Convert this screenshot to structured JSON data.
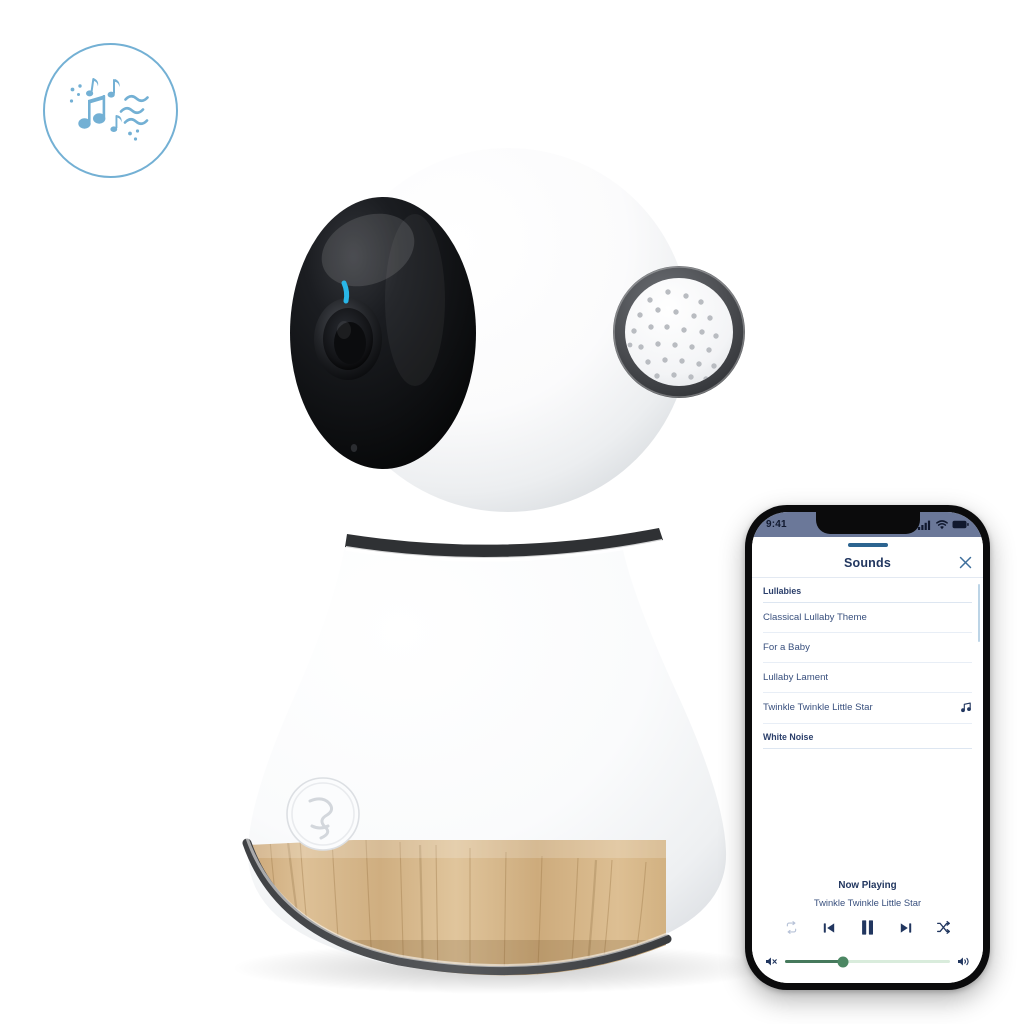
{
  "scene": {
    "background_color": "#ffffff",
    "badge": {
      "name": "sounds-feature-badge",
      "border_color": "#73b0d4",
      "icon": "music-notes-and-waves-icon"
    },
    "device": {
      "name": "baby-monitor-camera",
      "body_color": "#ffffff",
      "lens_face_color": "#111111",
      "led_color": "#29b6e8",
      "trim_color": "#4d4f52",
      "wood_color": "#d4b283",
      "speaker_ring_color": "#4a4c4f",
      "button_icon": "baby-logo-icon"
    }
  },
  "phone": {
    "frame_color": "#0b0b0c",
    "status_bar": {
      "background_color": "#6b7899",
      "time": "9:41",
      "cellular_icon": "signal-bars-icon",
      "wifi_icon": "wifi-icon",
      "battery_icon": "battery-icon"
    },
    "sheet": {
      "grabber_color": "#2c6490",
      "title": "Sounds",
      "close_icon": "close-icon",
      "accent_color": "#21365f"
    },
    "list": {
      "scrollbar_color": "#bcd4e6",
      "sections": [
        {
          "header": "Lullabies",
          "items": [
            {
              "label": "Classical Lullaby Theme",
              "icon": null
            },
            {
              "label": "For a Baby",
              "icon": null
            },
            {
              "label": "Lullaby Lament",
              "icon": null
            },
            {
              "label": "Twinkle Twinkle Little Star",
              "icon": "music-note-icon"
            }
          ]
        },
        {
          "header": "White Noise",
          "items": []
        }
      ]
    },
    "now_playing": {
      "title": "Now Playing",
      "track": "Twinkle Twinkle Little Star",
      "controls": [
        {
          "name": "repeat-button",
          "icon": "repeat-icon",
          "state": "inactive"
        },
        {
          "name": "previous-button",
          "icon": "previous-track-icon",
          "state": "active"
        },
        {
          "name": "pause-button",
          "icon": "pause-icon",
          "state": "active"
        },
        {
          "name": "next-button",
          "icon": "next-track-icon",
          "state": "active"
        },
        {
          "name": "shuffle-button",
          "icon": "shuffle-icon",
          "state": "active"
        }
      ]
    },
    "volume": {
      "mute_icon": "volume-mute-icon",
      "max_icon": "volume-up-icon",
      "level_percent": 35,
      "fill_color": "#46795c",
      "track_color": "#d9ecdc",
      "knob_color": "#4c8763"
    }
  }
}
